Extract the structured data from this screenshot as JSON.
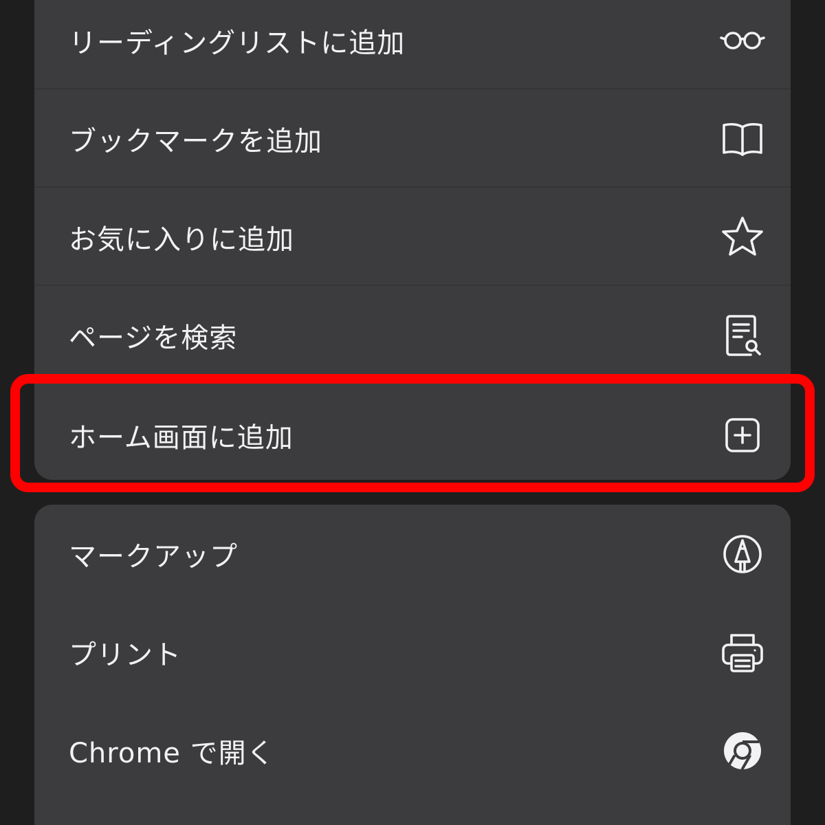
{
  "menu": {
    "group_top": [
      {
        "label": "リーディングリストに追加",
        "icon": "glasses-icon"
      },
      {
        "label": "ブックマークを追加",
        "icon": "book-icon"
      },
      {
        "label": "お気に入りに追加",
        "icon": "star-icon"
      },
      {
        "label": "ページを検索",
        "icon": "document-search-icon"
      },
      {
        "label": "ホーム画面に追加",
        "icon": "plus-square-icon",
        "highlighted": true
      }
    ],
    "group_bottom": [
      {
        "label": "マークアップ",
        "icon": "markup-pen-icon"
      },
      {
        "label": "プリント",
        "icon": "printer-icon"
      },
      {
        "label": "Chrome で開く",
        "icon": "chrome-icon"
      }
    ]
  },
  "colors": {
    "background": "#1e1e1f",
    "menu_background": "#3c3c3e",
    "separator": "#353537",
    "text": "#f2f2f4",
    "icon": "#f2f2f4",
    "highlight": "#ff0000"
  }
}
